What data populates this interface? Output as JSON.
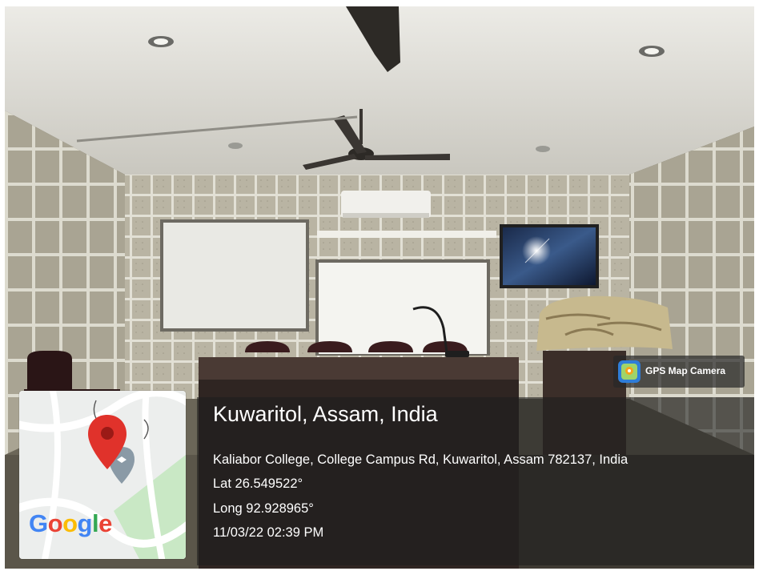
{
  "photo": {
    "description_icon": "photo-scene",
    "colors": {
      "ceiling": "#d9d8d2",
      "wall_panel": "#bdb8a8",
      "panel_grid": "#e4e2d8",
      "overlay": "#1e1e1e"
    }
  },
  "badge": {
    "icon": "gps-map-camera-icon",
    "label": "GPS Map Camera"
  },
  "location": {
    "place": "Kuwaritol, Assam, India",
    "address": "Kaliabor College, College Campus Rd, Kuwaritol, Assam 782137, India",
    "latitude": "Lat 26.549522°",
    "longitude": "Long 92.928965°",
    "datetime": "11/03/22 02:39 PM"
  },
  "map": {
    "icon": "map-pin-icon",
    "logo_letters": [
      "G",
      "o",
      "o",
      "g",
      "l",
      "e"
    ],
    "logo_colors": [
      "#4285F4",
      "#EA4335",
      "#FBBC05",
      "#4285F4",
      "#34A853",
      "#EA4335"
    ]
  }
}
